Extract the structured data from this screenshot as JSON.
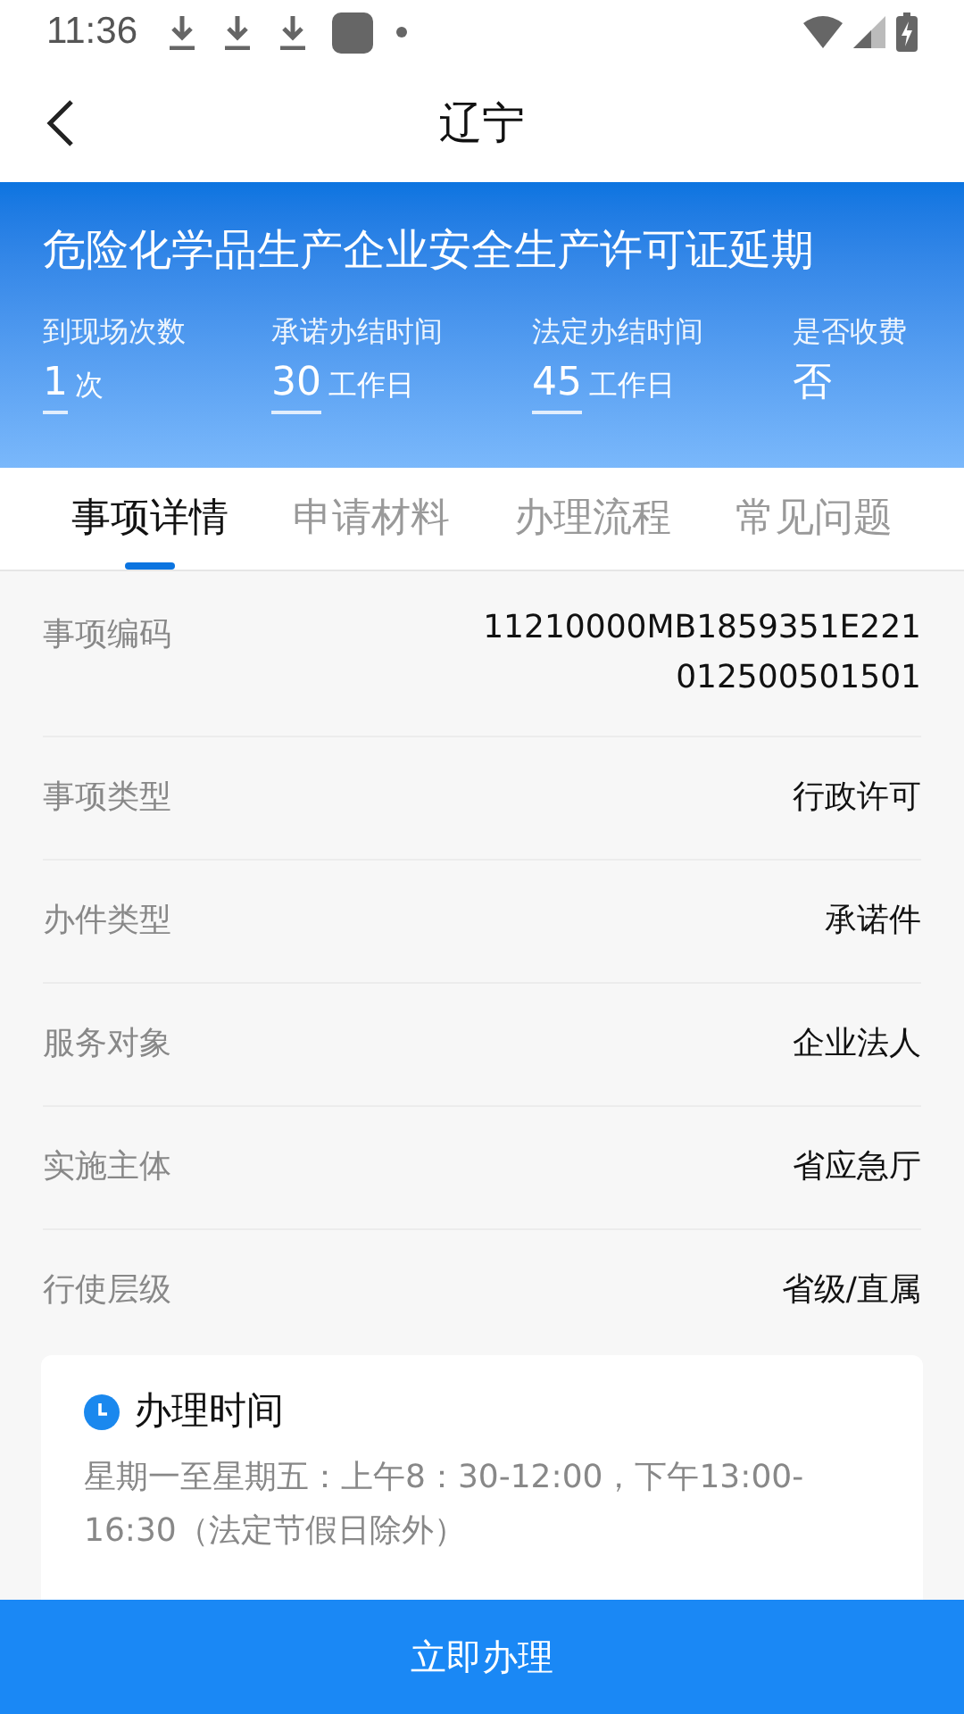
{
  "status_bar": {
    "time": "11:36"
  },
  "nav": {
    "title": "辽宁"
  },
  "header": {
    "title": "危险化学品生产企业安全生产许可证延期",
    "stats": [
      {
        "label": "到现场次数",
        "value": "1",
        "unit": "次",
        "underlined": true
      },
      {
        "label": "承诺办结时间",
        "value": "30",
        "unit": "工作日",
        "underlined": true
      },
      {
        "label": "法定办结时间",
        "value": "45",
        "unit": "工作日",
        "underlined": true
      },
      {
        "label": "是否收费",
        "value": "否",
        "underlined": false
      }
    ]
  },
  "tabs": [
    {
      "label": "事项详情",
      "selected": true
    },
    {
      "label": "申请材料",
      "selected": false
    },
    {
      "label": "办理流程",
      "selected": false
    },
    {
      "label": "常见问题",
      "selected": false
    }
  ],
  "details": [
    {
      "label": "事项编码",
      "value": "11210000MB1859351E221012500501501"
    },
    {
      "label": "事项类型",
      "value": "行政许可"
    },
    {
      "label": "办件类型",
      "value": "承诺件"
    },
    {
      "label": "服务对象",
      "value": "企业法人"
    },
    {
      "label": "实施主体",
      "value": "省应急厅"
    },
    {
      "label": "行使层级",
      "value": "省级/直属"
    }
  ],
  "hours_card": {
    "title": "办理时间",
    "text": "星期一至星期五：上午8：30-12:00，下午13:00-16:30（法定节假日除外）"
  },
  "action_button": "立即办理"
}
